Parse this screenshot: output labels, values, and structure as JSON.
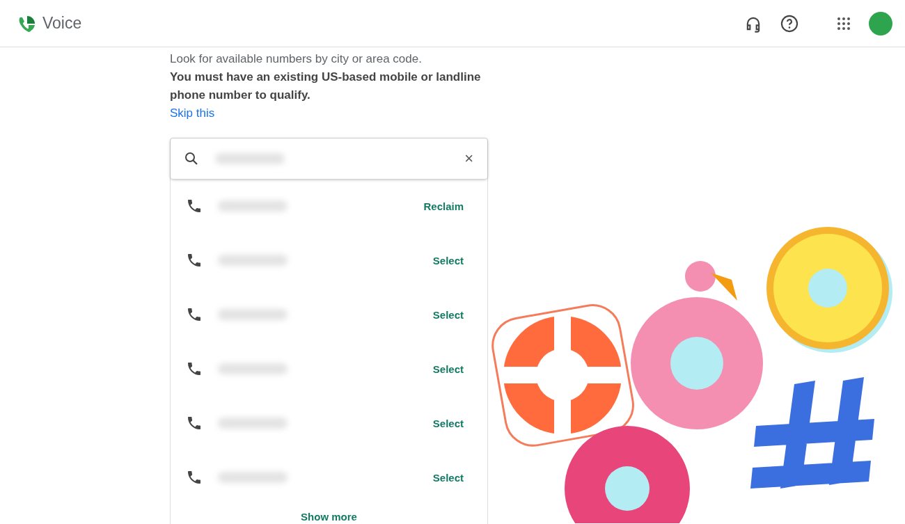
{
  "header": {
    "app_name": "Voice"
  },
  "intro": {
    "line": "Look for available numbers by city or area code.",
    "requirement": "You must have an existing US-based mobile or landline phone number to qualify.",
    "skip_link": "Skip this"
  },
  "search": {
    "clear_icon": "×"
  },
  "results": [
    {
      "action": "Reclaim"
    },
    {
      "action": "Select"
    },
    {
      "action": "Select"
    },
    {
      "action": "Select"
    },
    {
      "action": "Select"
    },
    {
      "action": "Select"
    }
  ],
  "show_more": "Show more"
}
